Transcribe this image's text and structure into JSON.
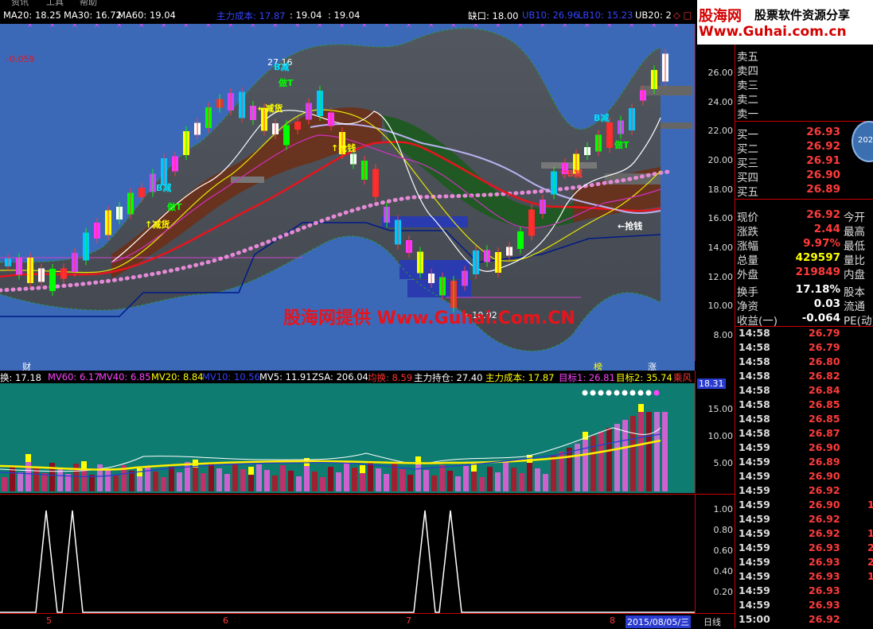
{
  "menu": [
    "资讯",
    "工具",
    "帮助"
  ],
  "top_indicators": [
    {
      "text": "MA20: 18.25",
      "color": "#ffffff"
    },
    {
      "text": "MA30: 16.72",
      "color": "#ffffff"
    },
    {
      "text": "MA60: 19.04",
      "color": "#ffffff"
    },
    {
      "text": "主力成本: 17.87",
      "color": "#3344ff"
    },
    {
      "text": ": 19.04",
      "color": "#ffffff"
    },
    {
      "text": ": 19.04",
      "color": "#ffffff"
    },
    {
      "text": "缺口: 18.00",
      "color": "#ffffff"
    },
    {
      "text": "UB10: 26.96",
      "color": "#3344ff"
    },
    {
      "text": "LB10: 15.23",
      "color": "#3344ff"
    },
    {
      "text": "UB20: 2",
      "color": "#ffffff"
    },
    {
      "text": "◇ □",
      "color": "#ff3333"
    }
  ],
  "chart_labels": {
    "low_mark": "-0.059",
    "peak_label": "27.16",
    "low_label": "←10.02",
    "cai": "财",
    "bang": "榜",
    "zhang": "涨",
    "signals": [
      "B减",
      "做T",
      "←抢钱",
      "↑抢钱",
      "B减",
      "做T",
      "▽B减",
      "B减",
      "做T",
      "←抢钱",
      "←减货",
      "↑减货",
      "做T"
    ]
  },
  "watermark": "股海网提供 Www.Guhai.Com.CN",
  "price_axis": [
    "26.00",
    "24.00",
    "22.00",
    "20.00",
    "18.00",
    "16.00",
    "14.00",
    "12.00",
    "10.00",
    "8.00"
  ],
  "volume_header": [
    {
      "text": "换: 17.18",
      "color": "#ffffff"
    },
    {
      "text": "MV60: 6.17",
      "color": "#ff44ff"
    },
    {
      "text": "MV40: 6.85",
      "color": "#ff44ff"
    },
    {
      "text": "MV20: 8.84",
      "color": "#ffff00"
    },
    {
      "text": "MV10: 10.56",
      "color": "#3344ff"
    },
    {
      "text": "MV5: 11.91",
      "color": "#ffffff"
    },
    {
      "text": "ZSA: 206.04",
      "color": "#ffffff"
    },
    {
      "text": "均换: 8.59",
      "color": "#ff3333"
    },
    {
      "text": "主力持仓: 27.40",
      "color": "#ffffff"
    },
    {
      "text": "主力成本: 17.87",
      "color": "#ffff00"
    },
    {
      "text": "目标1: 26.81",
      "color": "#ff44ff"
    },
    {
      "text": "目标2: 35.74",
      "color": "#ffff00"
    },
    {
      "text": "乘风",
      "color": "#ff3333"
    }
  ],
  "volume_axis": {
    "top": "18.31",
    "ticks": [
      "15.00",
      "10.00",
      "5.00"
    ]
  },
  "signal_axis": [
    "1.00",
    "0.80",
    "0.60",
    "0.40",
    "0.20"
  ],
  "date_axis": {
    "labels": [
      "5",
      "6",
      "7",
      "8"
    ],
    "current": "2015/08/05/三",
    "period": "日线"
  },
  "logo": {
    "name": "股海网",
    "slogan": "股票软件资源分享",
    "url": "Www.Guhai.com.cn"
  },
  "order_book": {
    "sells": [
      {
        "label": "卖五",
        "price": ""
      },
      {
        "label": "卖四",
        "price": ""
      },
      {
        "label": "卖三",
        "price": ""
      },
      {
        "label": "卖二",
        "price": ""
      },
      {
        "label": "卖一",
        "price": ""
      }
    ],
    "buys": [
      {
        "label": "买一",
        "price": "26.93"
      },
      {
        "label": "买二",
        "price": "26.92"
      },
      {
        "label": "买三",
        "price": "26.91"
      },
      {
        "label": "买四",
        "price": "26.90"
      },
      {
        "label": "买五",
        "price": "26.89"
      }
    ]
  },
  "quote": [
    {
      "label": "现价",
      "value": "26.92",
      "extra": "今开",
      "color": "#ff3b3b"
    },
    {
      "label": "涨跌",
      "value": "2.44",
      "extra": "最高",
      "color": "#ff3b3b"
    },
    {
      "label": "涨幅",
      "value": "9.97%",
      "extra": "最低",
      "color": "#ff3b3b"
    },
    {
      "label": "总量",
      "value": "429597",
      "extra": "量比",
      "color": "#ffff00"
    },
    {
      "label": "外盘",
      "value": "219849",
      "extra": "内盘",
      "color": "#ff3b3b"
    },
    {
      "label": "换手",
      "value": "17.18%",
      "extra": "股本",
      "color": "#ffffff"
    },
    {
      "label": "净资",
      "value": "0.03",
      "extra": "流通",
      "color": "#ffffff"
    },
    {
      "label": "收益(一)",
      "value": "-0.064",
      "extra": "PE(动)",
      "color": "#ffffff"
    }
  ],
  "ticks": [
    {
      "time": "14:58",
      "price": "26.79",
      "vol": ""
    },
    {
      "time": "14:58",
      "price": "26.79",
      "vol": ""
    },
    {
      "time": "14:58",
      "price": "26.80",
      "vol": ""
    },
    {
      "time": "14:58",
      "price": "26.82",
      "vol": ""
    },
    {
      "time": "14:58",
      "price": "26.84",
      "vol": ""
    },
    {
      "time": "14:58",
      "price": "26.85",
      "vol": ""
    },
    {
      "time": "14:58",
      "price": "26.85",
      "vol": ""
    },
    {
      "time": "14:58",
      "price": "26.87",
      "vol": ""
    },
    {
      "time": "14:59",
      "price": "26.90",
      "vol": ""
    },
    {
      "time": "14:59",
      "price": "26.89",
      "vol": ""
    },
    {
      "time": "14:59",
      "price": "26.90",
      "vol": ""
    },
    {
      "time": "14:59",
      "price": "26.92",
      "vol": ""
    },
    {
      "time": "14:59",
      "price": "26.90",
      "vol": "1"
    },
    {
      "time": "14:59",
      "price": "26.92",
      "vol": ""
    },
    {
      "time": "14:59",
      "price": "26.92",
      "vol": "1"
    },
    {
      "time": "14:59",
      "price": "26.93",
      "vol": "2"
    },
    {
      "time": "14:59",
      "price": "26.93",
      "vol": "2"
    },
    {
      "time": "14:59",
      "price": "26.93",
      "vol": "1"
    },
    {
      "time": "14:59",
      "price": "26.93",
      "vol": ""
    },
    {
      "time": "14:59",
      "price": "26.93",
      "vol": ""
    },
    {
      "time": "15:00",
      "price": "26.92",
      "vol": ""
    }
  ],
  "globe_text": "202",
  "colors": {
    "up": "#ff3b3b",
    "panel_bg": "#3b69b8",
    "vol_bg": "#0e7c70"
  }
}
